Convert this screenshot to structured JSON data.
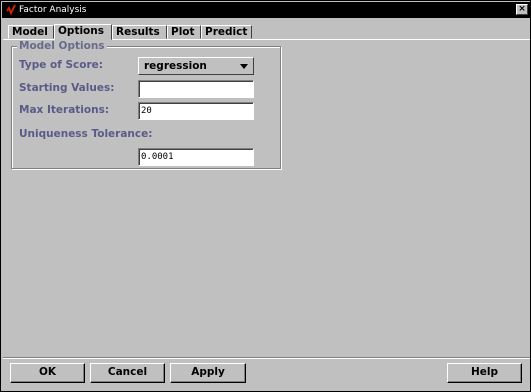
{
  "window": {
    "title": "Factor Analysis",
    "close_glyph": "×"
  },
  "tabs": [
    {
      "label": "Model",
      "active": false
    },
    {
      "label": "Options",
      "active": true
    },
    {
      "label": "Results",
      "active": false
    },
    {
      "label": "Plot",
      "active": false
    },
    {
      "label": "Predict",
      "active": false
    }
  ],
  "model_options": {
    "legend": "Model Options",
    "type_of_score": {
      "label": "Type of Score:",
      "value": "regression"
    },
    "starting_values": {
      "label": "Starting Values:",
      "value": ""
    },
    "max_iterations": {
      "label": "Max Iterations:",
      "value": "20"
    },
    "uniqueness_tolerance": {
      "label": "Uniqueness Tolerance:",
      "value": "0.0001"
    }
  },
  "buttons": {
    "ok": "OK",
    "cancel": "Cancel",
    "apply": "Apply",
    "help": "Help"
  },
  "colors": {
    "titlebar": "#000000",
    "face": "#c0c0c0",
    "label": "#5a5a8a",
    "icon": "#cc2200"
  },
  "icons": {
    "app": "app-red-check-icon",
    "dropdown": "dropdown-arrow-icon"
  }
}
